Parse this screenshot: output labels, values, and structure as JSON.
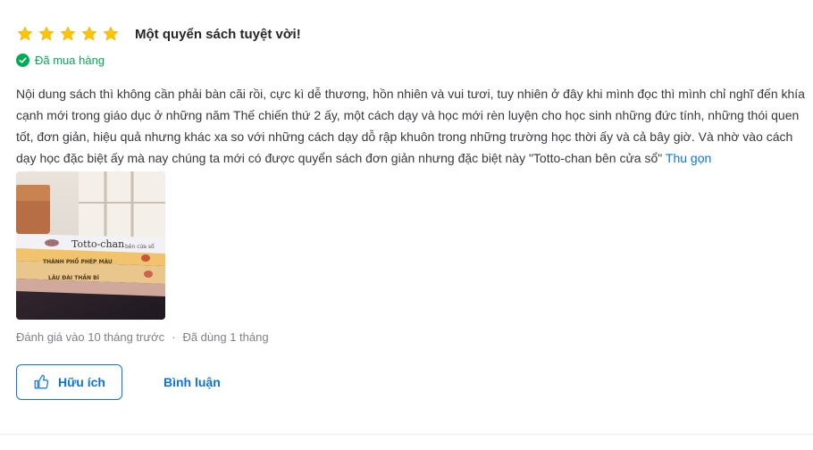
{
  "review": {
    "rating": 5,
    "rating_max": 5,
    "title": "Một quyển sách tuyệt vời!",
    "purchased_label": "Đã mua hàng",
    "content": "Nội dung sách thì không cần phải bàn cãi rồi, cực kì dễ thương, hồn nhiên và vui tươi, tuy nhiên ở đây khi mình đọc thì mình chỉ nghĩ đến khía cạnh mới trong giáo dục ở những năm Thế chiến thứ 2 ấy, một cách dạy và học mới rèn luyện cho học sinh những đức tính, những thói quen tốt, đơn giản, hiệu quả nhưng khác xa so với những cách dạy dỗ rập khuôn trong những trường học thời ấy và cả bây giờ. Và nhờ vào cách dạy học đặc biệt ấy mà nay chúng ta mới có được quyển sách đơn giản nhưng đặc biệt này \"Totto-chan bên cửa sổ\"",
    "collapse_label": "Thu gọn",
    "photo": {
      "book_top_title": "Totto-chan",
      "book_top_subtitle": "bên cửa sổ",
      "book_middle_title": "THÀNH PHỐ PHÉP MÀU",
      "book_bottom_title": "LÂU ĐÀI THẦN BÍ"
    },
    "reviewed_time": "Đánh giá vào 10 tháng trước",
    "separator": "·",
    "used_time": "Đã dùng 1 tháng",
    "helpful_label": "Hữu ích",
    "comment_label": "Bình luận"
  },
  "colors": {
    "star": "#ffc400",
    "accent": "#0b74e5",
    "success": "#00ab56",
    "muted": "#808089"
  },
  "icons": {
    "star": "star-icon",
    "check": "check-circle-icon",
    "thumb": "thumbs-up-icon"
  }
}
